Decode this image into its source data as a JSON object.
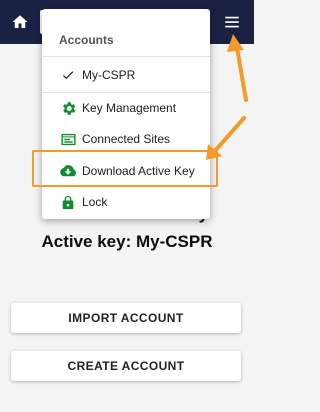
{
  "header": {
    "home_icon": "home-icon",
    "menu_icon": "hamburger-menu-icon",
    "background_color": "#1b2143"
  },
  "menu": {
    "header": "Accounts",
    "items": [
      {
        "label": "My-CSPR",
        "icon": "checkmark-icon",
        "icon_color": "#1a1a1a"
      },
      {
        "label": "Key Management",
        "icon": "gear-icon",
        "icon_color": "#128b2e"
      },
      {
        "label": "Connected Sites",
        "icon": "browser-window-icon",
        "icon_color": "#128b2e"
      },
      {
        "label": "Download Active Key",
        "icon": "cloud-download-icon",
        "icon_color": "#128b2e"
      },
      {
        "label": "Lock",
        "icon": "lock-icon",
        "icon_color": "#128b2e"
      }
    ]
  },
  "main": {
    "title_line1": "Y                              y",
    "title_line2": "Active key: My-CSPR"
  },
  "buttons": {
    "import": "IMPORT ACCOUNT",
    "create": "CREATE ACCOUNT"
  },
  "annotations": {
    "highlight_color": "#f39a2b",
    "arrow_color": "#f39a2b"
  }
}
